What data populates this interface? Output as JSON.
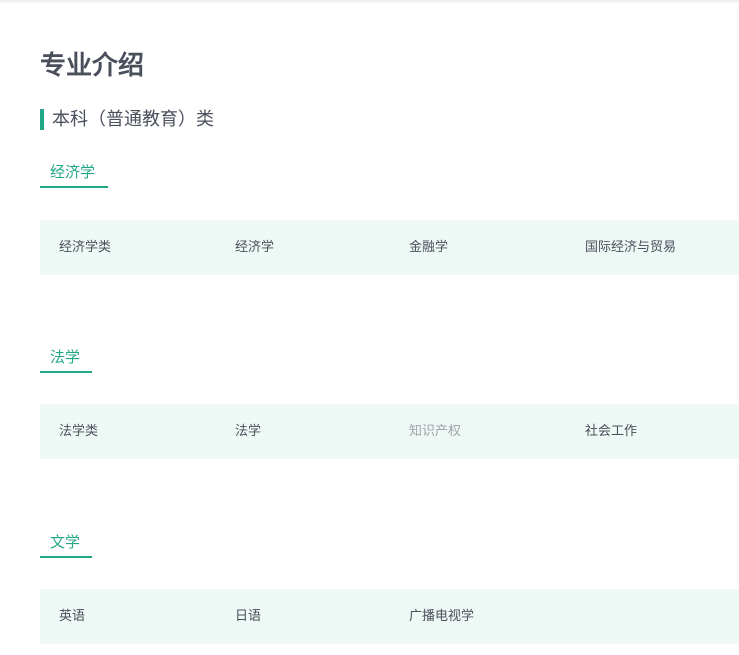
{
  "page": {
    "title": "专业介绍"
  },
  "category": {
    "label": "本科（普通教育）类"
  },
  "sections": [
    {
      "tab_label": "经济学",
      "majors": [
        {
          "label": "经济学类",
          "active": true
        },
        {
          "label": "经济学",
          "active": true
        },
        {
          "label": "金融学",
          "active": true
        },
        {
          "label": "国际经济与贸易",
          "active": true
        }
      ]
    },
    {
      "tab_label": "法学",
      "majors": [
        {
          "label": "法学类",
          "active": true
        },
        {
          "label": "法学",
          "active": true
        },
        {
          "label": "知识产权",
          "active": false
        },
        {
          "label": "社会工作",
          "active": true
        }
      ]
    },
    {
      "tab_label": "文学",
      "majors": [
        {
          "label": "英语",
          "active": true
        },
        {
          "label": "日语",
          "active": true
        },
        {
          "label": "广播电视学",
          "active": true
        }
      ]
    }
  ],
  "colors": {
    "accent": "#23a887",
    "row_background": "#eef8f4",
    "text": "#4a4f5c",
    "disabled_text": "#a0a4ac"
  }
}
